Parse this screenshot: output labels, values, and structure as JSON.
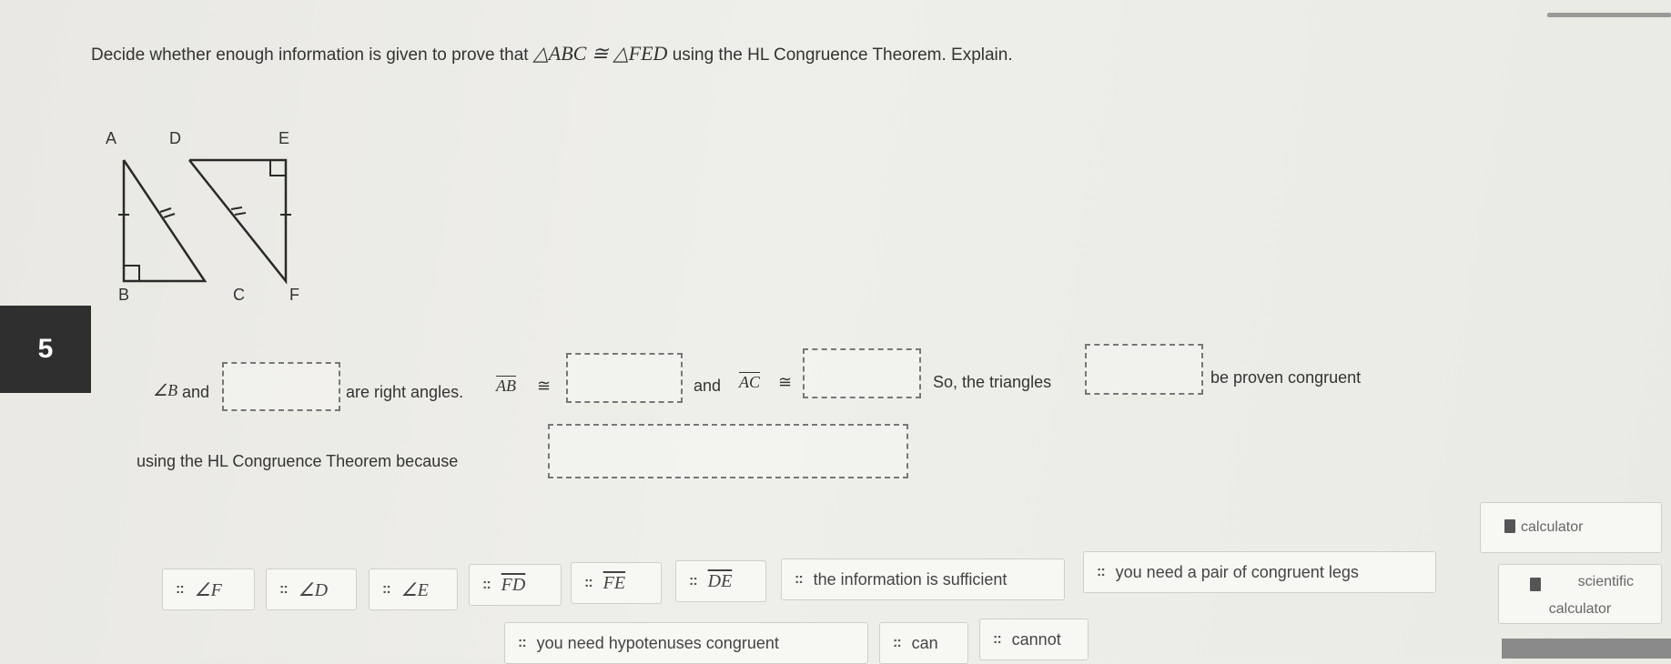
{
  "question": {
    "number": "5",
    "prompt_text": "Decide whether enough information is given to prove that",
    "prompt_math": "△ABC ≅ △FED",
    "prompt_tail": "using the HL Congruence Theorem. Explain."
  },
  "figure": {
    "labels": {
      "A": "A",
      "B": "B",
      "C": "C",
      "D": "D",
      "E": "E",
      "F": "F"
    }
  },
  "statement": {
    "angle_b": "∠B",
    "and1": "and",
    "are_right_angles": "are right angles.",
    "ab_seg": "AB",
    "cong1": "≅",
    "and2": "and",
    "ac_seg": "AC",
    "cong2": "≅",
    "so_triangles": "So, the triangles",
    "be_proven": "be proven congruent",
    "using_hl": "using the HL Congruence Theorem because"
  },
  "choices": [
    {
      "label": "∠F",
      "math": true,
      "overline": false
    },
    {
      "label": "∠D",
      "math": true,
      "overline": false
    },
    {
      "label": "∠E",
      "math": true,
      "overline": false
    },
    {
      "label": "FD",
      "math": true,
      "overline": true
    },
    {
      "label": "FE",
      "math": true,
      "overline": true
    },
    {
      "label": "DE",
      "math": true,
      "overline": true
    },
    {
      "label": "the information is sufficient",
      "math": false,
      "overline": false
    },
    {
      "label": "you need a pair of congruent legs",
      "math": false,
      "overline": false
    },
    {
      "label": "you need hypotenuses congruent",
      "math": false,
      "overline": false
    },
    {
      "label": "can",
      "math": false,
      "overline": false
    },
    {
      "label": "cannot",
      "math": false,
      "overline": false
    }
  ],
  "tools": {
    "calculator": "calculator",
    "scientific_line1": "scientific",
    "scientific_line2": "calculator"
  }
}
